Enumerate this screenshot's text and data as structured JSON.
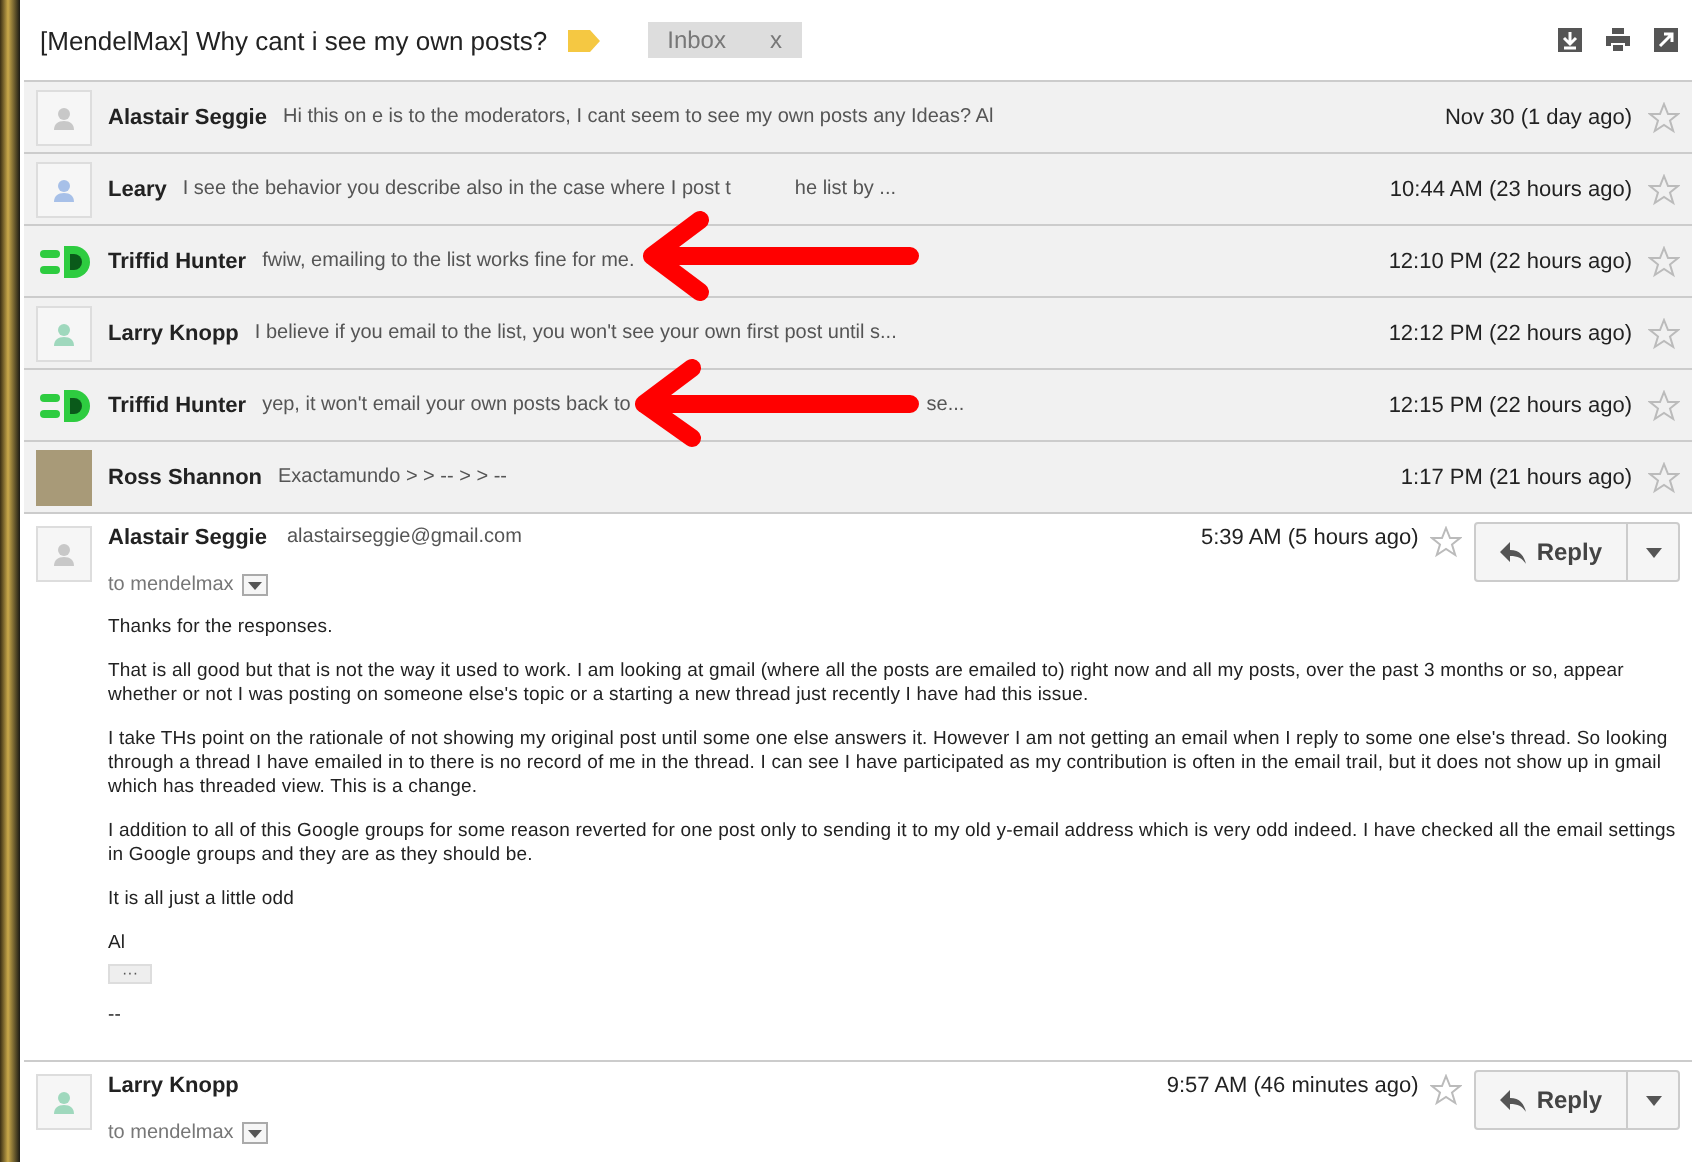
{
  "thread": {
    "subject": "[MendelMax] Why cant i see my own posts?",
    "label_chip": {
      "text": "Inbox",
      "remove": "x"
    }
  },
  "collapsed": [
    {
      "sender": "Alastair Seggie",
      "snippet": "Hi this on e is to the moderators, I cant seem to see my own posts any Ideas? Al",
      "time": "Nov 30 (1 day ago)",
      "starred": false,
      "avatar": {
        "kind": "silhouette",
        "color": "#c8c8c8"
      }
    },
    {
      "sender": "Leary",
      "snippet": "I see the behavior you describe also in the case where I post t",
      "snippet_tail": "he list by ...",
      "time": "10:44 AM (23 hours ago)",
      "starred": false,
      "avatar": {
        "kind": "silhouette",
        "color": "#a7c0e8"
      }
    },
    {
      "sender": "Triffid Hunter",
      "snippet": "fwiw, emailing to the list works fine for me.",
      "time": "12:10 PM (22 hours ago)",
      "starred": false,
      "avatar": {
        "kind": "logo",
        "color": "#2ecc40"
      }
    },
    {
      "sender": "Larry Knopp",
      "snippet": "I believe if you email to the list, you won't see your own first post until s...",
      "time": "12:12 PM (22 hours ago)",
      "starred": false,
      "avatar": {
        "kind": "silhouette",
        "color": "#9fd8bd"
      }
    },
    {
      "sender": "Triffid Hunter",
      "snippet": "yep, it won't email your own posts back to",
      "snippet_tail": "se...",
      "time": "12:15 PM (22 hours ago)",
      "starred": false,
      "avatar": {
        "kind": "logo",
        "color": "#2ecc40"
      }
    },
    {
      "sender": "Ross Shannon",
      "snippet": "Exactamundo > > -- > > --",
      "time": "1:17 PM (21 hours ago)",
      "starred": false,
      "avatar": {
        "kind": "photo",
        "color": "#a89a78"
      }
    }
  ],
  "expanded": [
    {
      "sender": "Alastair Seggie",
      "email": "alastairseggie@gmail.com",
      "time": "5:39 AM (5 hours ago)",
      "starred": false,
      "avatar": {
        "kind": "silhouette",
        "color": "#c8c8c8"
      },
      "to": "to mendelmax",
      "reply": "Reply",
      "body": [
        "Thanks for the responses.",
        "That is all good but that is not the way it used to work. I am looking at gmail (where all the posts are emailed to) right now and all my posts, over the past 3 months or so, appear whether or not I was posting on someone else's topic or a starting a new thread just recently I have had this issue.",
        "I take THs point on the rationale of not showing my original post until some one else answers it. However I am not getting an email when I reply to some one else's thread.  So looking through a thread I have emailed in to there is no record of me in the thread. I can see I have participated as my contribution is often in the email trail, but it does not show up in gmail which has threaded view. This is a change.",
        "I addition to all of this Google groups for some reason reverted for one post only to sending it to my old y-email address which is very odd indeed. I have checked all the email settings in Google groups and they are as they should be.",
        "It is all just a little odd",
        "Al"
      ],
      "quoted": "···",
      "signature": "--"
    },
    {
      "sender": "Larry Knopp",
      "time": "9:57 AM (46 minutes ago)",
      "starred": false,
      "avatar": {
        "kind": "silhouette",
        "color": "#9fd8bd"
      },
      "to": "to mendelmax",
      "reply": "Reply"
    }
  ]
}
